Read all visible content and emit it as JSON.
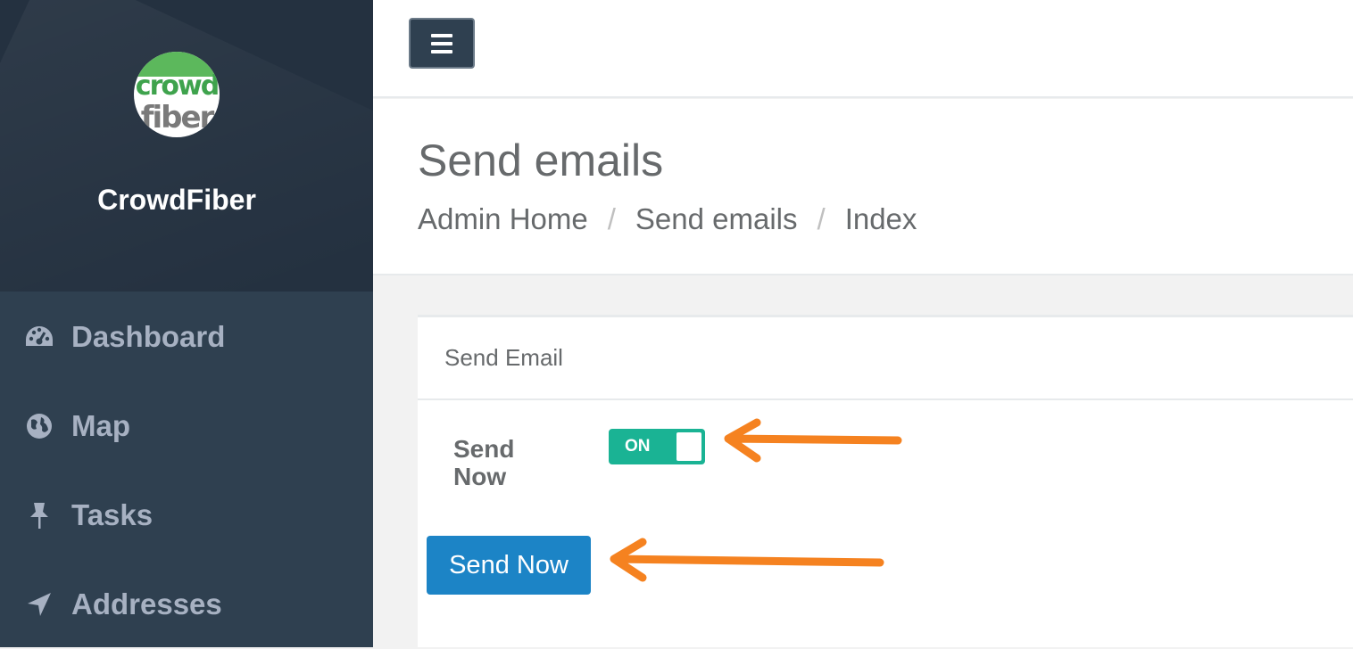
{
  "sidebar": {
    "brand": "CrowdFiber",
    "logo": {
      "line1": "crowd",
      "line2": "fiber",
      "colors": {
        "green": "#5cb85c",
        "gray": "#7a7a7a"
      }
    },
    "items": [
      {
        "label": "Dashboard",
        "icon": "dashboard-icon"
      },
      {
        "label": "Map",
        "icon": "globe-icon"
      },
      {
        "label": "Tasks",
        "icon": "pushpin-icon"
      },
      {
        "label": "Addresses",
        "icon": "location-arrow-icon"
      }
    ],
    "colors": {
      "background": "#2f4050",
      "profile_background": "#243140",
      "text": "#a7b1c2"
    }
  },
  "topbar": {
    "menu_icon": "hamburger-icon"
  },
  "header": {
    "title": "Send emails",
    "breadcrumb": [
      "Admin Home",
      "Send emails",
      "Index"
    ],
    "separator": "/"
  },
  "panel": {
    "title": "Send Email",
    "field_label": "Send Now",
    "toggle": {
      "state_label": "ON",
      "value": true,
      "color": "#1ab394"
    },
    "button_label": "Send Now",
    "button_color": "#1c84c6"
  },
  "annotations": {
    "arrow_color": "#f58220",
    "arrows": [
      "toggle-pointer-arrow",
      "button-pointer-arrow"
    ]
  }
}
